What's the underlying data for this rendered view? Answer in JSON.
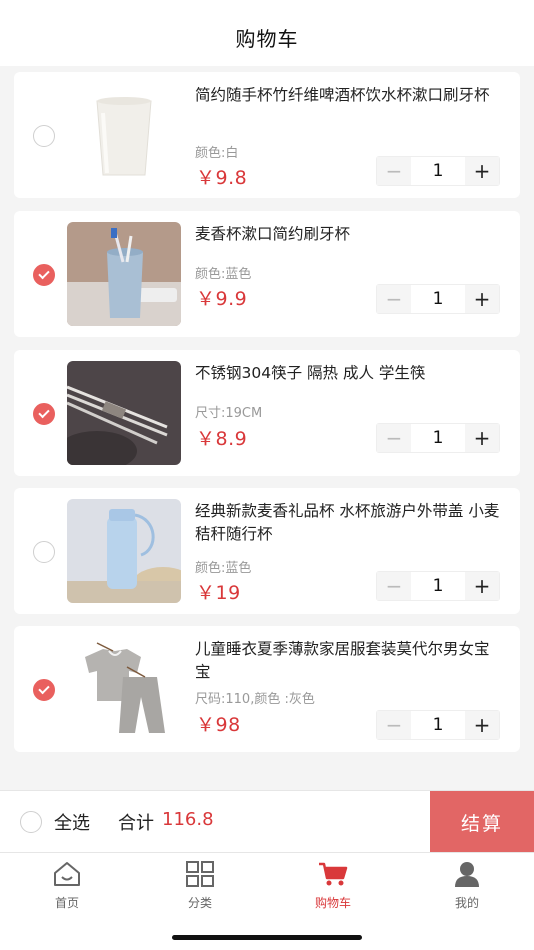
{
  "header": {
    "title": "购物车"
  },
  "items": [
    {
      "name": "简约随手杯竹纤维啤酒杯饮水杯漱口刷牙杯",
      "spec": "颜色:白",
      "price": "￥9.8",
      "qty": "1",
      "checked": false
    },
    {
      "name": "麦香杯漱口简约刷牙杯",
      "spec": "颜色:蓝色",
      "price": "￥9.9",
      "qty": "1",
      "checked": true
    },
    {
      "name": "不锈钢304筷子 隔热 成人 学生筷",
      "spec": "尺寸:19CM",
      "price": "￥8.9",
      "qty": "1",
      "checked": true
    },
    {
      "name": "经典新款麦香礼品杯 水杯旅游户外带盖 小麦秸秆随行杯",
      "spec": "颜色:蓝色",
      "price": "￥19",
      "qty": "1",
      "checked": false
    },
    {
      "name": "儿童睡衣夏季薄款家居服套装莫代尔男女宝宝",
      "spec": "尺码:110,颜色 :灰色",
      "price": "￥98",
      "qty": "1",
      "checked": true
    }
  ],
  "stepper": {
    "minus": "−",
    "plus": "+"
  },
  "bottom": {
    "select_all": "全选",
    "total_label": "合计",
    "total_value": "116.8",
    "checkout": "结算"
  },
  "tabs": [
    {
      "label": "首页",
      "icon": "home-icon"
    },
    {
      "label": "分类",
      "icon": "grid-icon"
    },
    {
      "label": "购物车",
      "icon": "cart-icon",
      "active": true
    },
    {
      "label": "我的",
      "icon": "user-icon"
    }
  ],
  "colors": {
    "accent": "#d9383a",
    "checkout": "#e26665",
    "checked": "#e9605e"
  }
}
